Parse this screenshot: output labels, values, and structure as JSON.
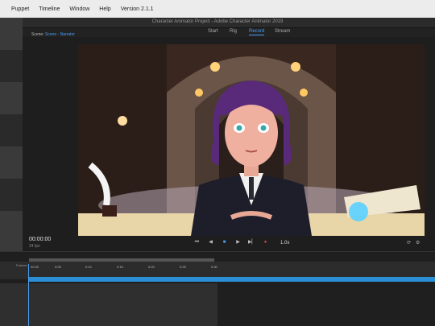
{
  "menubar": {
    "items": [
      "",
      "Puppet",
      "Timeline",
      "Window",
      "Help",
      "Version 2.1.1"
    ]
  },
  "window": {
    "title": "Character Animator Project - Adobe Character Animator 2019"
  },
  "workspaces": [
    "Start",
    "Rig",
    "Record",
    "Stream"
  ],
  "active_workspace": "Record",
  "scene": {
    "tab_prefix": "Scene:",
    "tab_name": "Scene - Narrator",
    "current_time": "00:00:00",
    "fps": "24 fps",
    "playback_rate": "1.0x"
  },
  "timeline": {
    "frames_label": "Frames",
    "ticks": [
      "00:00",
      "0:05",
      "0:10",
      "0:15",
      "0:20",
      "0:25",
      "0:30"
    ],
    "accent": "#2a8fd6"
  },
  "colors": {
    "accent": "#4a9ef0",
    "record": "#e54848"
  }
}
